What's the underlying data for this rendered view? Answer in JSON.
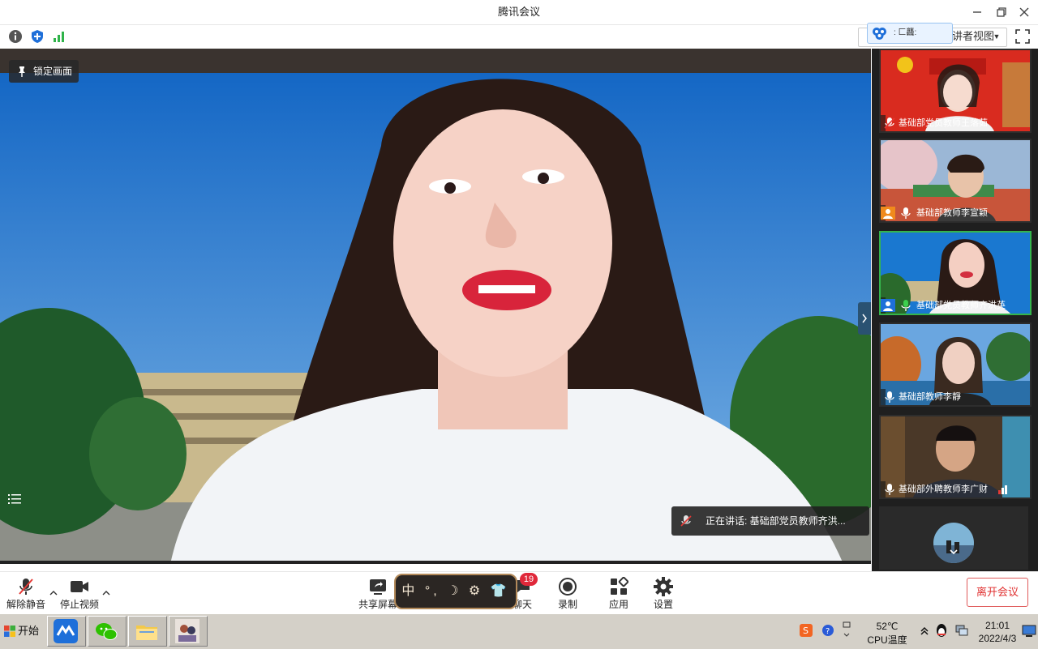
{
  "window": {
    "title": "腾讯会议",
    "minimize_icon": "minimize-icon",
    "restore_icon": "restore-icon",
    "close_icon": "close-icon"
  },
  "infobar": {
    "icons": [
      "info-icon",
      "shield-icon",
      "signal-icon"
    ],
    "view_select_label": "讲者视图",
    "floating_label": ": 匚龘:"
  },
  "main": {
    "lock_label": "锁定画面",
    "speaking_prefix": "正在讲话: 基础部党员教师齐洪...",
    "colors": {
      "sky": "#1a74c9",
      "shirt": "#f5f7fa"
    }
  },
  "sidebar": {
    "participants": [
      {
        "name": "基础部党员教师王落茹",
        "mic": "muted",
        "active": false
      },
      {
        "name": "基础部教师李宣颖",
        "mic": "on",
        "active": false
      },
      {
        "name": "基础部党员教师齐洪英",
        "mic": "on",
        "active": true
      },
      {
        "name": "基础部教师李靜",
        "mic": "on",
        "active": false
      },
      {
        "name": "基础部外聘教师李广财",
        "mic": "on",
        "active": false
      }
    ],
    "collapse_icon": "chevron-right-icon"
  },
  "toolbar": {
    "unmute_label": "解除静音",
    "stop_video_label": "停止视频",
    "share_label": "共享屏幕",
    "chat_label": "聊天",
    "chat_badge": "19",
    "record_label": "录制",
    "apps_label": "应用",
    "settings_label": "设置",
    "leave_label": "离开会议",
    "ime_chars": "中 °, ☽ ⚙ 👕"
  },
  "taskbar": {
    "start_label": "开始",
    "cpu_temp": "52℃",
    "cpu_label": "CPU温度",
    "time": "21:01",
    "date": "2022/4/3"
  }
}
